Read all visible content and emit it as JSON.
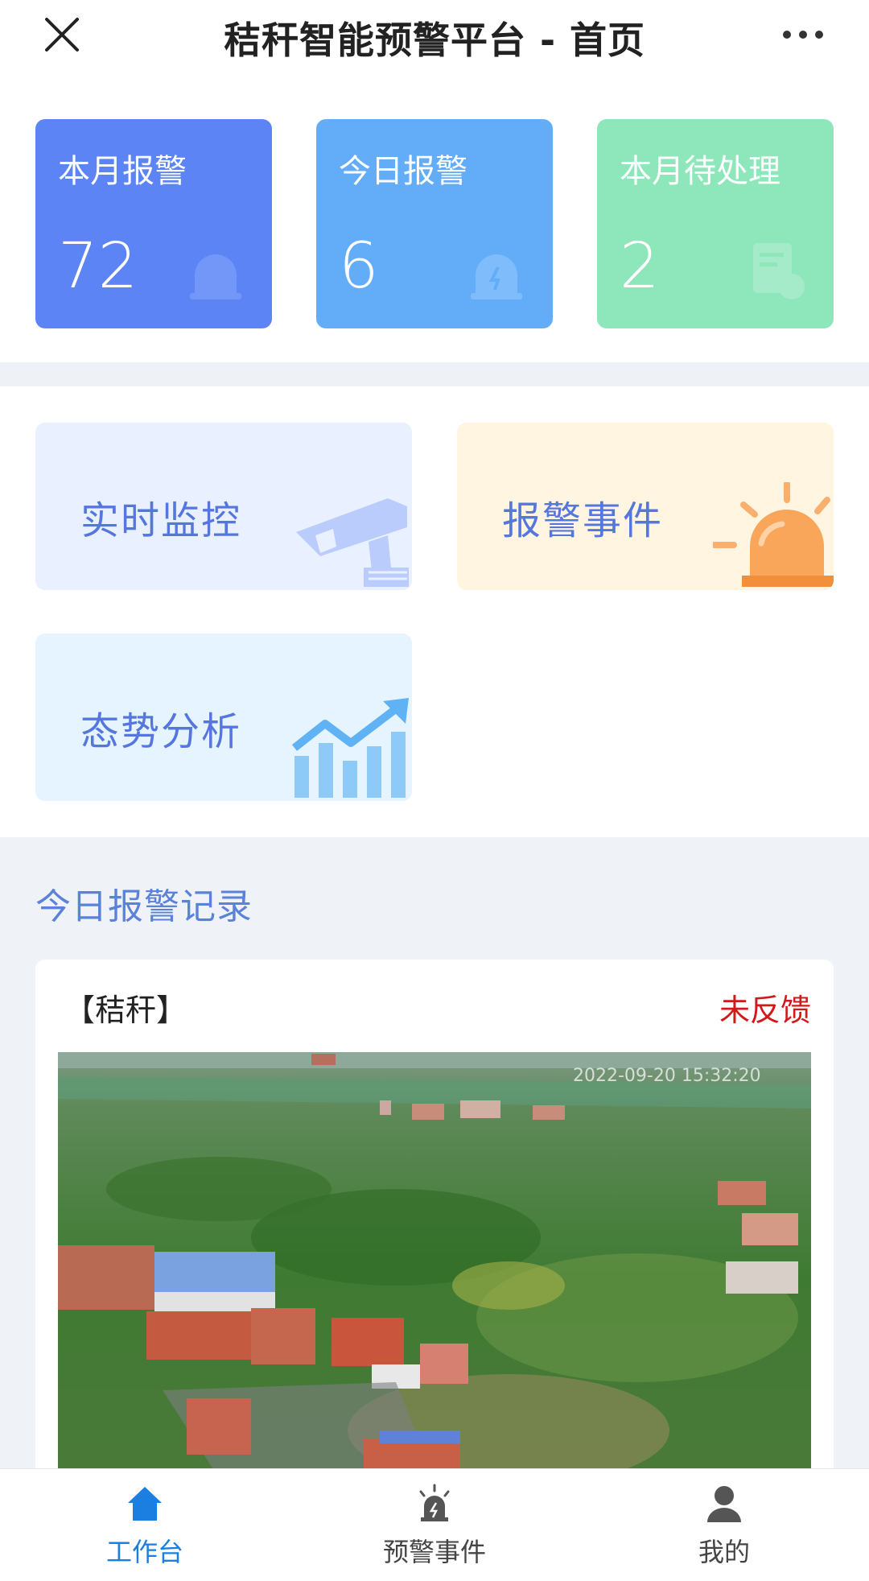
{
  "header": {
    "title": "秸秆智能预警平台 - 首页"
  },
  "stats": [
    {
      "label": "本月报警",
      "value": "72",
      "color": "#5c84f4"
    },
    {
      "label": "今日报警",
      "value": "6",
      "color": "#63adf8"
    },
    {
      "label": "本月待处理",
      "value": "2",
      "color": "#8ee6bb"
    }
  ],
  "actions": [
    {
      "label": "实时监控",
      "icon": "camera-icon"
    },
    {
      "label": "报警事件",
      "icon": "alarm-icon"
    },
    {
      "label": "态势分析",
      "icon": "chart-icon"
    }
  ],
  "records": {
    "title": "今日报警记录",
    "items": [
      {
        "tag": "【秸秆】",
        "status": "未反馈",
        "image_timestamp": "2022-09-20 15:32:20"
      }
    ]
  },
  "tabbar": [
    {
      "label": "工作台",
      "active": true
    },
    {
      "label": "预警事件",
      "active": false
    },
    {
      "label": "我的",
      "active": false
    }
  ],
  "colors": {
    "accent": "#1a7fe0",
    "alert_red": "#d0191b",
    "section_title": "#5a82d9"
  }
}
